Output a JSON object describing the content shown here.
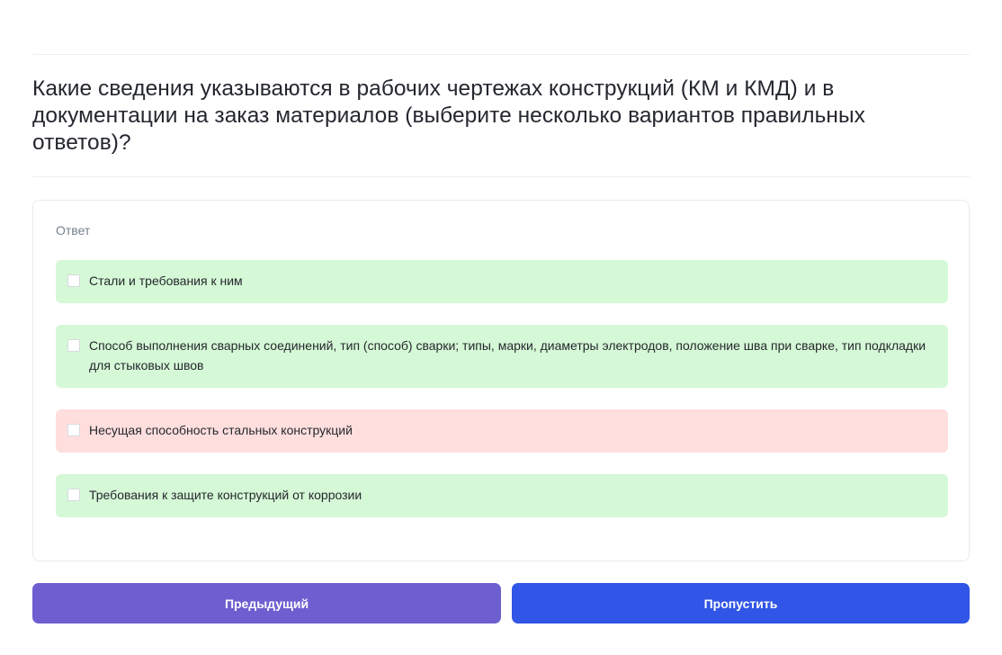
{
  "question": {
    "text": "Какие сведения указываются в рабочих чертежах конструкций (КМ и КМД) и в документации на заказ материалов (выберите несколько вариантов правильных ответов)?"
  },
  "answer": {
    "heading": "Ответ",
    "options": [
      {
        "label": "Стали и требования к ним",
        "checked": false,
        "status": "correct"
      },
      {
        "label": "Способ выполнения сварных соединений, тип (способ) сварки; типы, марки, диаметры электродов, положение шва при сварке, тип подкладки для стыковых швов",
        "checked": false,
        "status": "correct"
      },
      {
        "label": "Несущая способность стальных конструкций",
        "checked": false,
        "status": "incorrect"
      },
      {
        "label": "Требования к защите конструкций от коррозии",
        "checked": false,
        "status": "correct"
      }
    ]
  },
  "buttons": {
    "previous_label": "Предыдущий",
    "skip_label": "Пропустить"
  },
  "colors": {
    "correct_background": "#d5f8d6",
    "incorrect_background": "#ffdede",
    "previous_button": "#6e5fd0",
    "skip_button": "#3155e6"
  }
}
